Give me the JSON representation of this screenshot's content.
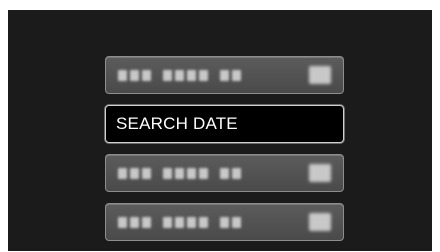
{
  "menu": {
    "items": [
      {
        "label": "",
        "selected": false
      },
      {
        "label": "SEARCH DATE",
        "selected": true
      },
      {
        "label": "",
        "selected": false
      },
      {
        "label": "",
        "selected": false
      }
    ]
  }
}
